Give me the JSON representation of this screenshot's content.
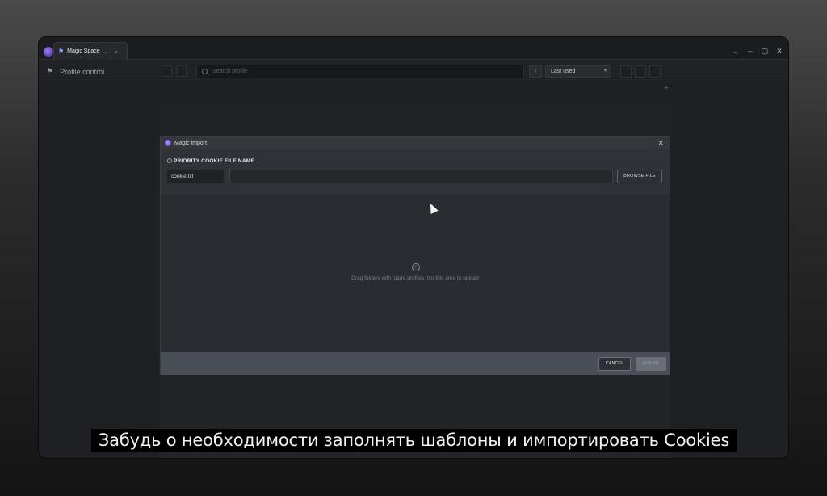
{
  "window": {
    "tab_label": "Magic Space",
    "toolbar": {
      "page_title": "Profile control",
      "search_placeholder": "Search profile",
      "sort_label": "Last used"
    }
  },
  "dialog": {
    "title": "Magic import",
    "cookie_label": "PRIORITY COOKIE FILE NAME",
    "cookie_file_value": "cookie.txt",
    "browse_label": "BROWSE FILE",
    "drop_hint": "Drag folders with future profiles into this area to upload",
    "cancel_label": "CANCEL",
    "import_label": "IMPORT"
  },
  "subtitle": "Забудь о необходимости заполнять шаблоны и импортировать Cookies"
}
